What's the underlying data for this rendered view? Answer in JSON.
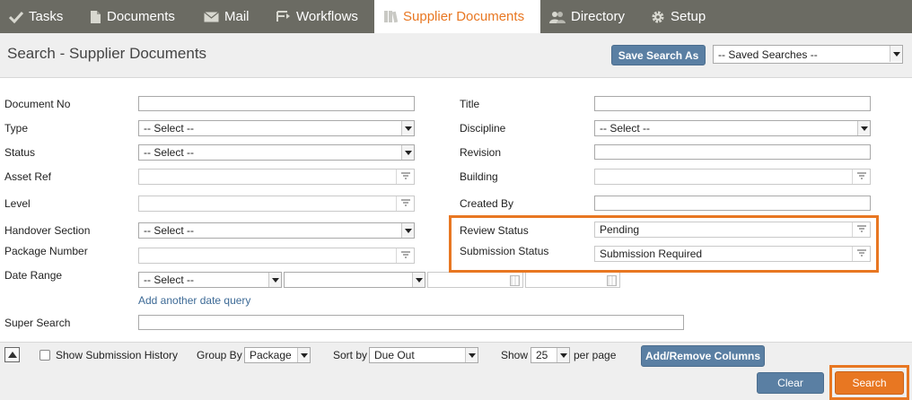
{
  "nav": {
    "tabs": [
      {
        "label": "Tasks",
        "icon": "checkmark-icon"
      },
      {
        "label": "Documents",
        "icon": "document-icon"
      },
      {
        "label": "Mail",
        "icon": "envelope-icon"
      },
      {
        "label": "Workflows",
        "icon": "workflow-icon"
      },
      {
        "label": "Supplier Documents",
        "icon": "binders-icon",
        "active": true
      },
      {
        "label": "Directory",
        "icon": "people-icon"
      },
      {
        "label": "Setup",
        "icon": "gear-icon"
      }
    ]
  },
  "header": {
    "title": "Search - Supplier Documents",
    "save_search_label": "Save Search As",
    "saved_searches_value": "-- Saved Searches --"
  },
  "form": {
    "document_no_label": "Document No",
    "type_label": "Type",
    "type_value": "-- Select --",
    "status_label": "Status",
    "status_value": "-- Select --",
    "asset_ref_label": "Asset Ref",
    "level_label": "Level",
    "handover_section_label": "Handover Section",
    "handover_section_value": "-- Select --",
    "package_number_label": "Package Number",
    "date_range_label": "Date Range",
    "date_range_value": "-- Select --",
    "add_date_query_label": "Add another date query",
    "super_search_label": "Super Search",
    "title_label": "Title",
    "discipline_label": "Discipline",
    "discipline_value": "-- Select --",
    "revision_label": "Revision",
    "building_label": "Building",
    "created_by_label": "Created By",
    "review_status_label": "Review Status",
    "review_status_value": "Pending",
    "submission_status_label": "Submission Status",
    "submission_status_value": "Submission Required"
  },
  "footer": {
    "show_submission_history_label": "Show Submission History",
    "group_by_label": "Group By",
    "group_by_value": "Package",
    "sort_by_label": "Sort by",
    "sort_by_value": "Due Out",
    "show_label": "Show",
    "show_value": "25",
    "per_page_label": "per page",
    "add_remove_columns_label": "Add/Remove Columns",
    "clear_label": "Clear",
    "search_label": "Search"
  },
  "colors": {
    "nav_bg": "#6b6b63",
    "accent": "#e87722",
    "button_blue": "#5a7fa3",
    "link": "#3d6a96"
  }
}
